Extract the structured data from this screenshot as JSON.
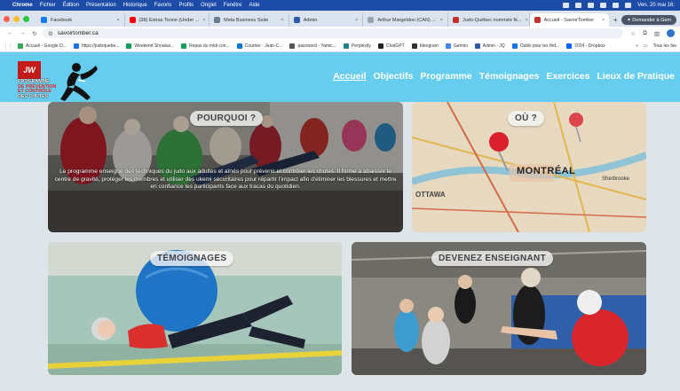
{
  "menubar": {
    "app": "Chrome",
    "items": [
      "Fichier",
      "Édition",
      "Présentation",
      "Historique",
      "Favoris",
      "Profils",
      "Onglet",
      "Fenêtre",
      "Aide"
    ],
    "clock": "Ven. 20 mai 16:"
  },
  "tabs": [
    {
      "label": "Facebook",
      "color": "#1877f2"
    },
    {
      "label": "(38) Extras Tonne (Under ...",
      "color": "#ff0000"
    },
    {
      "label": "Meta Business Suite",
      "color": "#6b7c93"
    },
    {
      "label": "Admin",
      "color": "#2f5aa8"
    },
    {
      "label": "Arthur Margeldon (CAN) ...",
      "color": "#9aa4b1"
    },
    {
      "label": "Judo-Québec nommée fé...",
      "color": "#c4302b"
    },
    {
      "label": "Accueil - SavoirTomber",
      "color": "#c4302b"
    }
  ],
  "ask_gemini": "Demander à Gem",
  "address": {
    "url": "savoirtomber.ca"
  },
  "bookmarks": [
    {
      "label": "Accueil - Google D...",
      "color": "#34a853"
    },
    {
      "label": "https://judoquebe...",
      "color": "#1a73e8"
    },
    {
      "label": "Weekend Shoukai...",
      "color": "#0f9d58"
    },
    {
      "label": "Repas du midi con...",
      "color": "#0f9d58"
    },
    {
      "label": "Courrier - Jean-C...",
      "color": "#0078d4"
    },
    {
      "label": "password - Yamic...",
      "color": "#555555"
    },
    {
      "label": "Perplexity",
      "color": "#20808d"
    },
    {
      "label": "ChatGPT",
      "color": "#222222"
    },
    {
      "label": "Ideogram",
      "color": "#333333"
    },
    {
      "label": "Gemini",
      "color": "#4285f4"
    },
    {
      "label": "Admin - JQ",
      "color": "#2f5aa8"
    },
    {
      "label": "Outils pour les fêd...",
      "color": "#1a73e8"
    },
    {
      "label": "2024 - Dropbox",
      "color": "#0061ff"
    }
  ],
  "bookmarks_all": "Tous les fav",
  "site": {
    "logo_box": "JW",
    "logo_lines": [
      "PROGRAMME",
      "DE PRÉVENTION",
      "ET CONTRÔLE",
      "DES CHUTES"
    ],
    "nav": [
      "Accueil",
      "Objectifs",
      "Programme",
      "Témoignages",
      "Exercices",
      "Lieux de Pratique"
    ]
  },
  "cards": {
    "pourquoi": {
      "title": "POURQUOI ?",
      "text": "Le programme enseigne des techniques du judo aux adultes et aînés pour prévenir et contrôler les chutes. Il forme à abaisser le centre de gravité, protéger les membres et utiliser des ukemi sécuritaires pour répartir l'impact afin d'éliminer les blessures et mettre en confiance les participants face aux tracas du quotidien."
    },
    "ou": {
      "title": "OÙ ?",
      "map_labels": [
        "MONTRÉAL",
        "Sherbrooke",
        "OTTAWA"
      ]
    },
    "temoignages": {
      "title": "TÉMOIGNAGES"
    },
    "enseignant": {
      "title": "DEVENEZ ENSEIGNANT"
    }
  }
}
